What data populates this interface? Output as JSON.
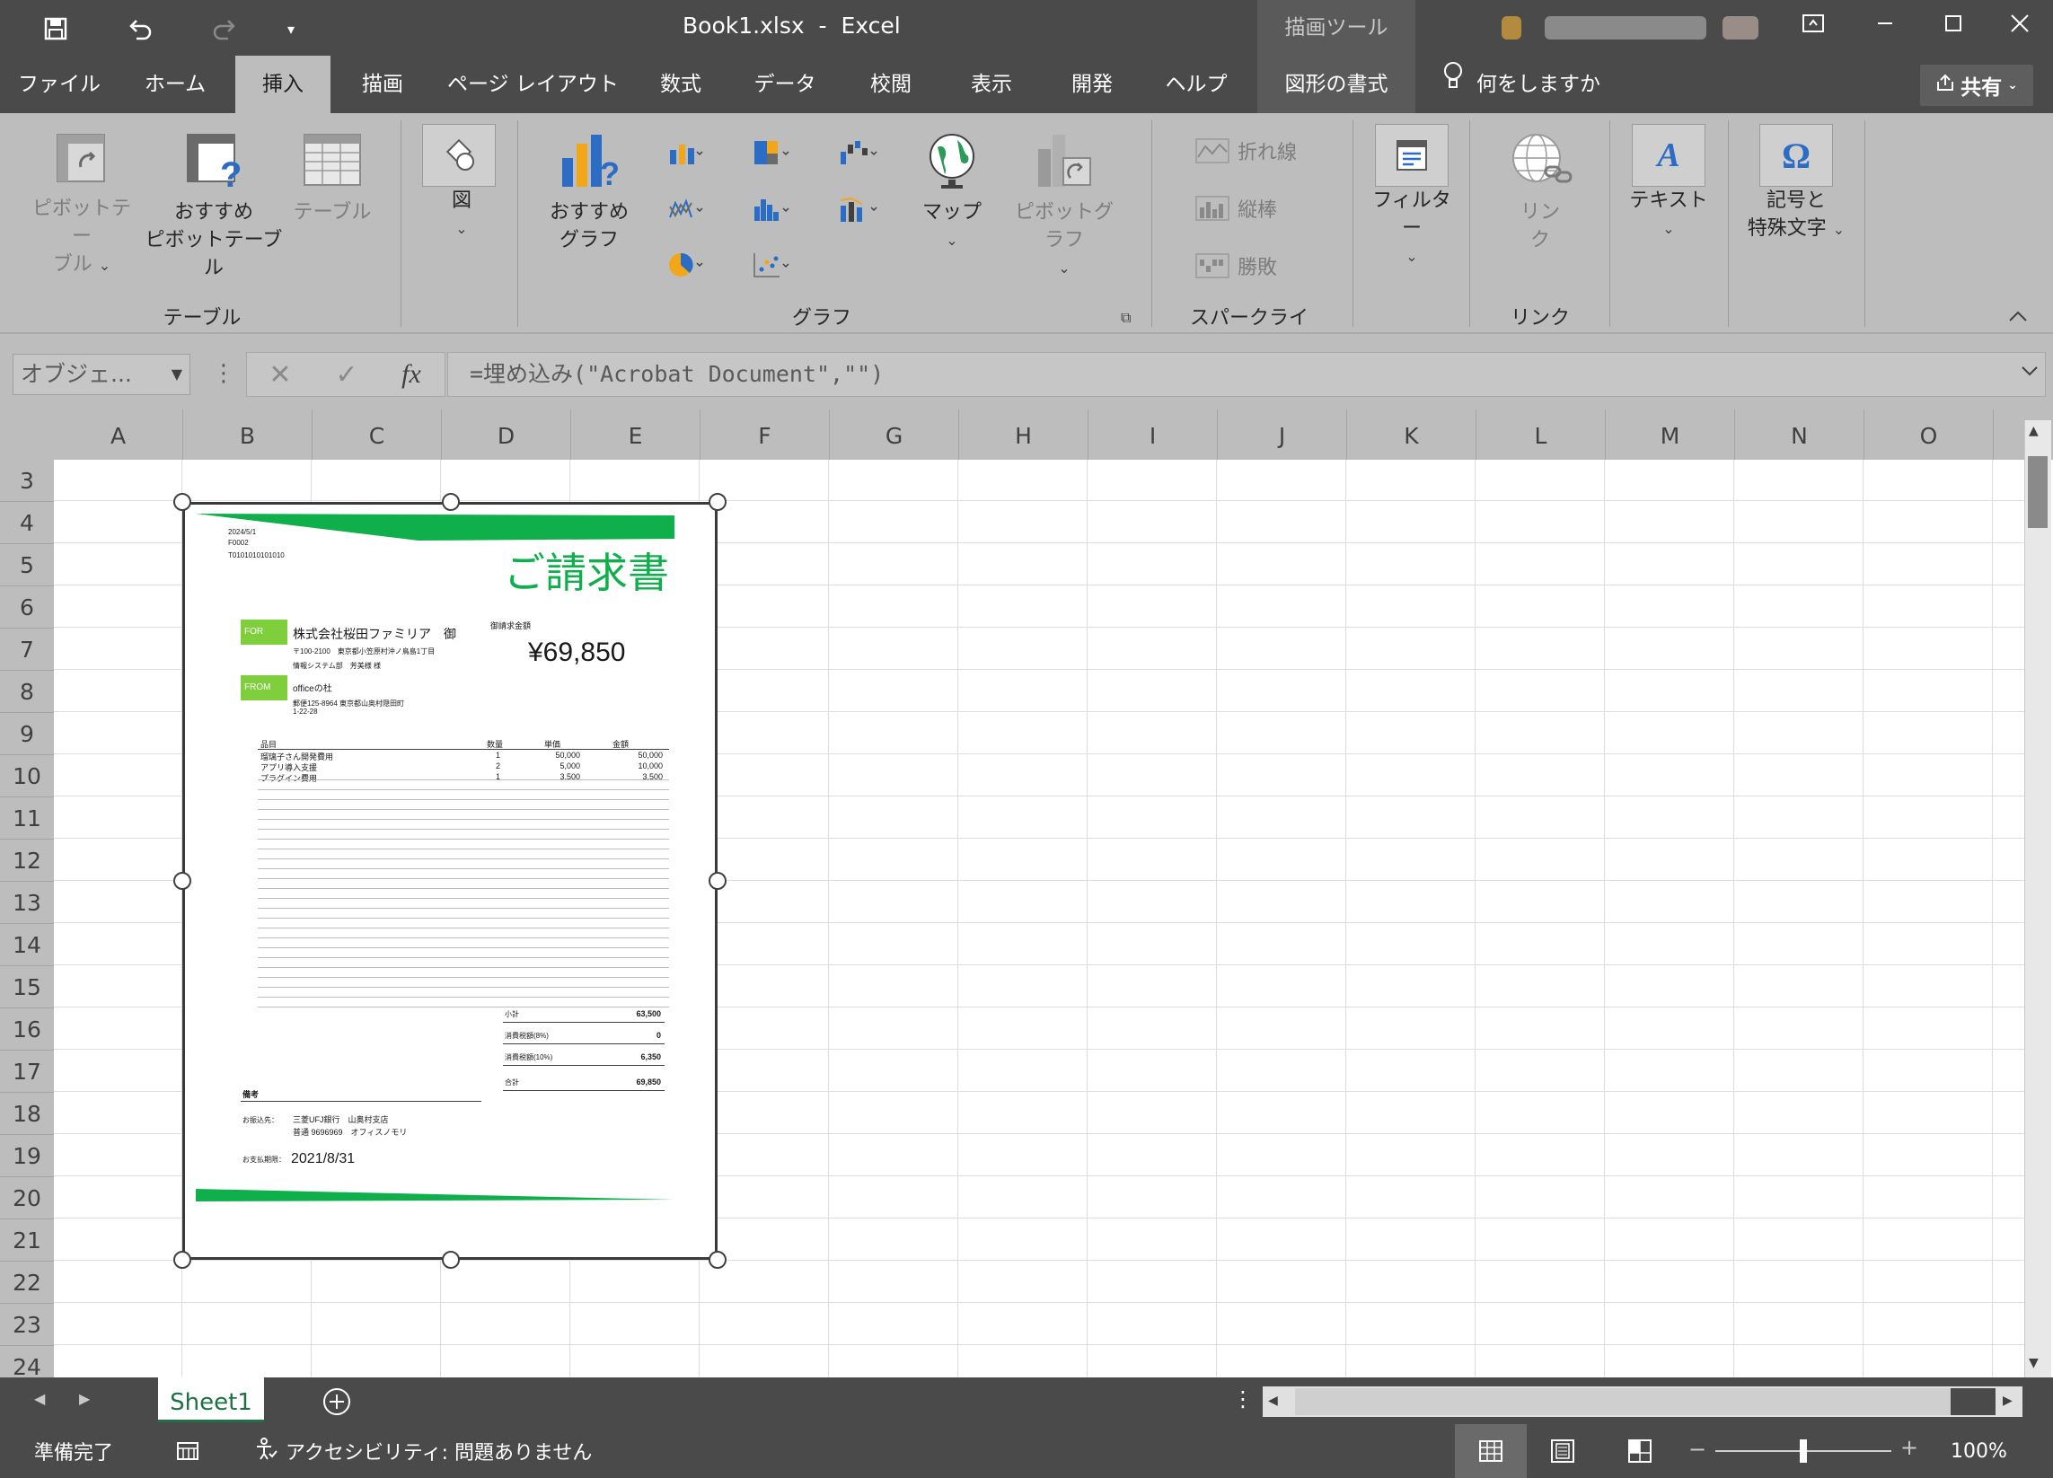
{
  "window": {
    "title": "Book1.xlsx  -  Excel",
    "context_group": "描画ツール",
    "controls": {
      "ribbon_options": "ribbon-display-options-icon",
      "minimize": "minimize-icon",
      "maximize": "maximize-icon",
      "close": "close-icon"
    }
  },
  "quick_access": {
    "save": "save-icon",
    "undo": "undo-icon",
    "redo": "redo-icon",
    "customize": "customize-icon"
  },
  "tabs": [
    "ファイル",
    "ホーム",
    "挿入",
    "描画",
    "ページ レイアウト",
    "数式",
    "データ",
    "校閲",
    "表示",
    "開発",
    "ヘルプ",
    "図形の書式"
  ],
  "active_tab": "挿入",
  "tell_me": "何をしますか",
  "share": "共有",
  "ribbon": {
    "pivot_table": "ピボットテーブル",
    "pivot_table_lines": [
      "ピボットテー",
      "ブル"
    ],
    "recommended_pivot_lines": [
      "おすすめ",
      "ピボットテーブル"
    ],
    "table": "テーブル",
    "illustrations": "図",
    "recommended_charts_lines": [
      "おすすめ",
      "グラフ"
    ],
    "maps": "マップ",
    "pivot_chart": "ピボットグラフ",
    "sparkline_line": "折れ線",
    "sparkline_column": "縦棒",
    "sparkline_winloss": "勝敗",
    "filter": "フィルター",
    "link_lines": [
      "リン",
      "ク"
    ],
    "text": "テキスト",
    "symbols_lines": [
      "記号と",
      "特殊文字"
    ],
    "groups": {
      "table": "テーブル",
      "chart": "グラフ",
      "sparkline": "スパークライン",
      "link": "リンク"
    }
  },
  "formula_bar": {
    "name_box": "オブジェ...",
    "cancel": "✕",
    "enter": "✓",
    "fx": "fx",
    "formula": "=埋め込み(\"Acrobat Document\",\"\")"
  },
  "columns": [
    "A",
    "B",
    "C",
    "D",
    "E",
    "F",
    "G",
    "H",
    "I",
    "J",
    "K",
    "L",
    "M",
    "N",
    "O"
  ],
  "rows": [
    "3",
    "4",
    "5",
    "6",
    "7",
    "8",
    "9",
    "10",
    "11",
    "12",
    "13",
    "14",
    "15",
    "16",
    "17",
    "18",
    "19",
    "20",
    "21",
    "22",
    "23",
    "24"
  ],
  "invoice": {
    "date": "2024/5/1",
    "number": "F0002",
    "registration": "T0101010101010",
    "heading": "ご請求書",
    "for_tag": "FOR",
    "to_company": "株式会社桜田ファミリア　御",
    "to_address": "〒100-2100　東京都小笠原村沖ノ鳥島1丁目",
    "to_dept": "情報システム部　芳美様 様",
    "amount_label": "御請求金額",
    "amount": "¥69,850",
    "from_tag": "FROM",
    "from_name": "officeの杜",
    "from_address1": "郵便125-8964 東京都山奥村隠田町",
    "from_address2": "1-22-28",
    "item_headers": [
      "品目",
      "数量",
      "単価",
      "金額"
    ],
    "items": [
      [
        "瑠璃子さん開発費用",
        "1",
        "50,000",
        "50,000"
      ],
      [
        "アプリ導入支援",
        "2",
        "5,000",
        "10,000"
      ],
      [
        "プラグイン費用",
        "1",
        "3,500",
        "3,500"
      ]
    ],
    "totals": [
      [
        "小計",
        "63,500"
      ],
      [
        "消費税額(8%)",
        "0"
      ],
      [
        "消費税額(10%)",
        "6,350"
      ],
      [
        "合計",
        "69,850"
      ]
    ],
    "notes_label": "備考",
    "bank_label": "お振込先：",
    "bank_line1": "三菱UFJ銀行　山奥村支店",
    "bank_line2": "普通 9696969　オフィスノモリ",
    "due_label": "お支払期限：",
    "due_date": "2021/8/31"
  },
  "sheet_tabs": [
    "Sheet1"
  ],
  "status": {
    "ready": "準備完了",
    "accessibility": "アクセシビリティ: 問題ありません",
    "zoom": "100%",
    "zoom_level": 0.5
  },
  "colors": {
    "ribbon_bg": "#bdbdbd",
    "titlebar_bg": "#4a4a4a",
    "invoice_green": "#0fb04b",
    "tag_green": "#7fce3c",
    "sheet_tab_green": "#1e7145"
  }
}
